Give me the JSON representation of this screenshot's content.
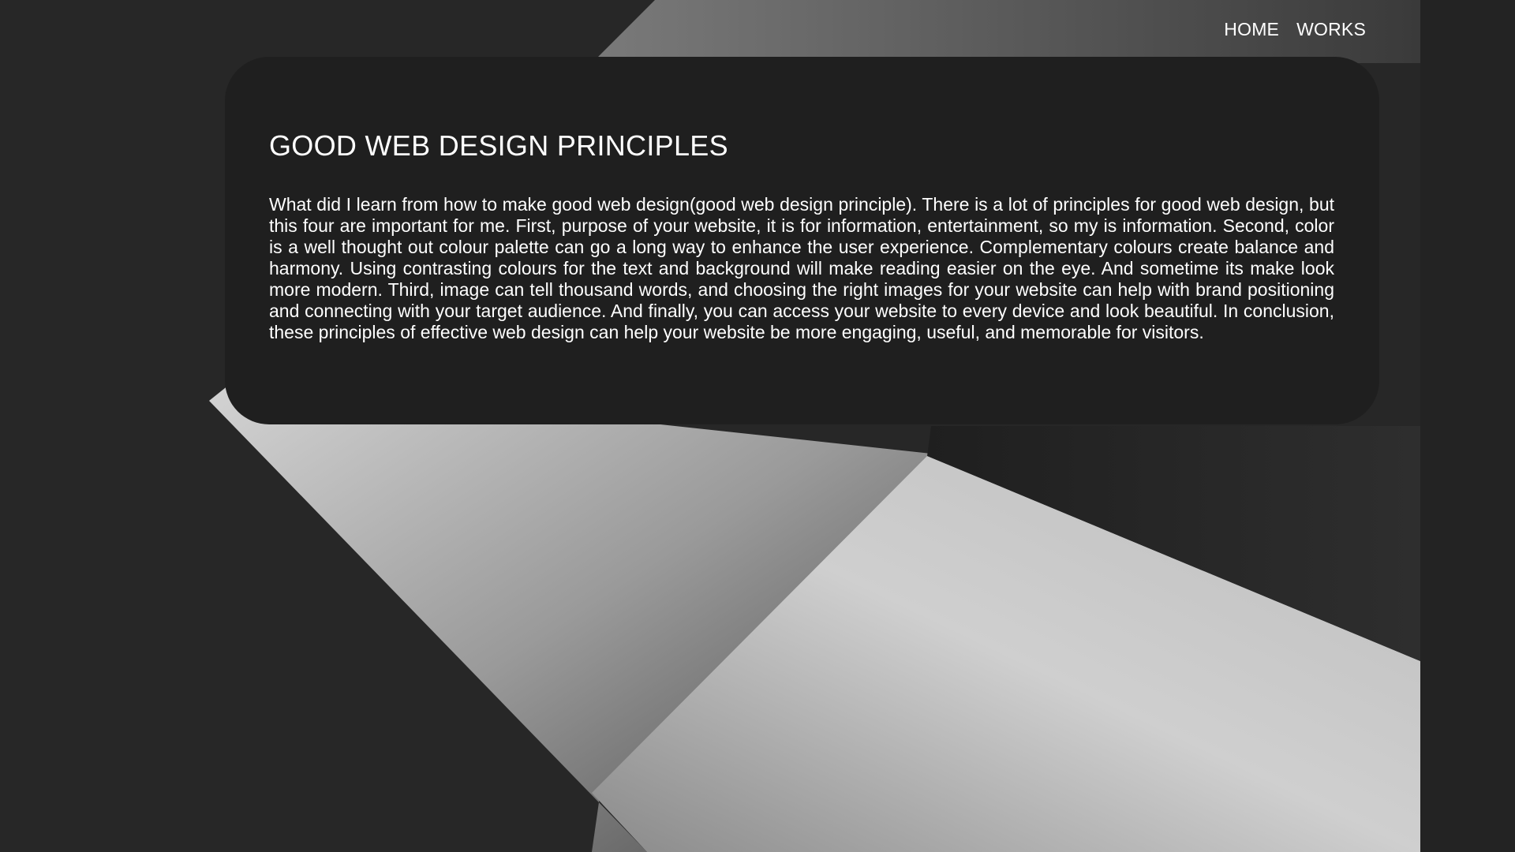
{
  "nav": {
    "items": [
      {
        "label": "HOME"
      },
      {
        "label": "WORKS"
      }
    ]
  },
  "article": {
    "title": "GOOD WEB DESIGN PRINCIPLES",
    "body": "What did I learn from how to make good web design(good web design principle). There is a lot of principles for good web design, but this four are important for me. First, purpose of your website, it is for information, entertainment, so my is information. Second, color is a well thought out colour palette can go a long way to enhance the user experience. Complementary colours create balance and harmony. Using contrasting colours for the text and background will make reading easier on the eye. And sometime its make look more modern. Third, image can tell thousand words, and choosing the right images for your website can help with brand positioning and connecting with your target audience. And finally, you can access your website to every device and look beautiful. In conclusion, these principles of effective web design can help your website be more engaging, useful, and memorable for visitors."
  },
  "colors": {
    "page_background": "#262626",
    "card_background": "#1f1f1f",
    "text": "#ffffff"
  }
}
